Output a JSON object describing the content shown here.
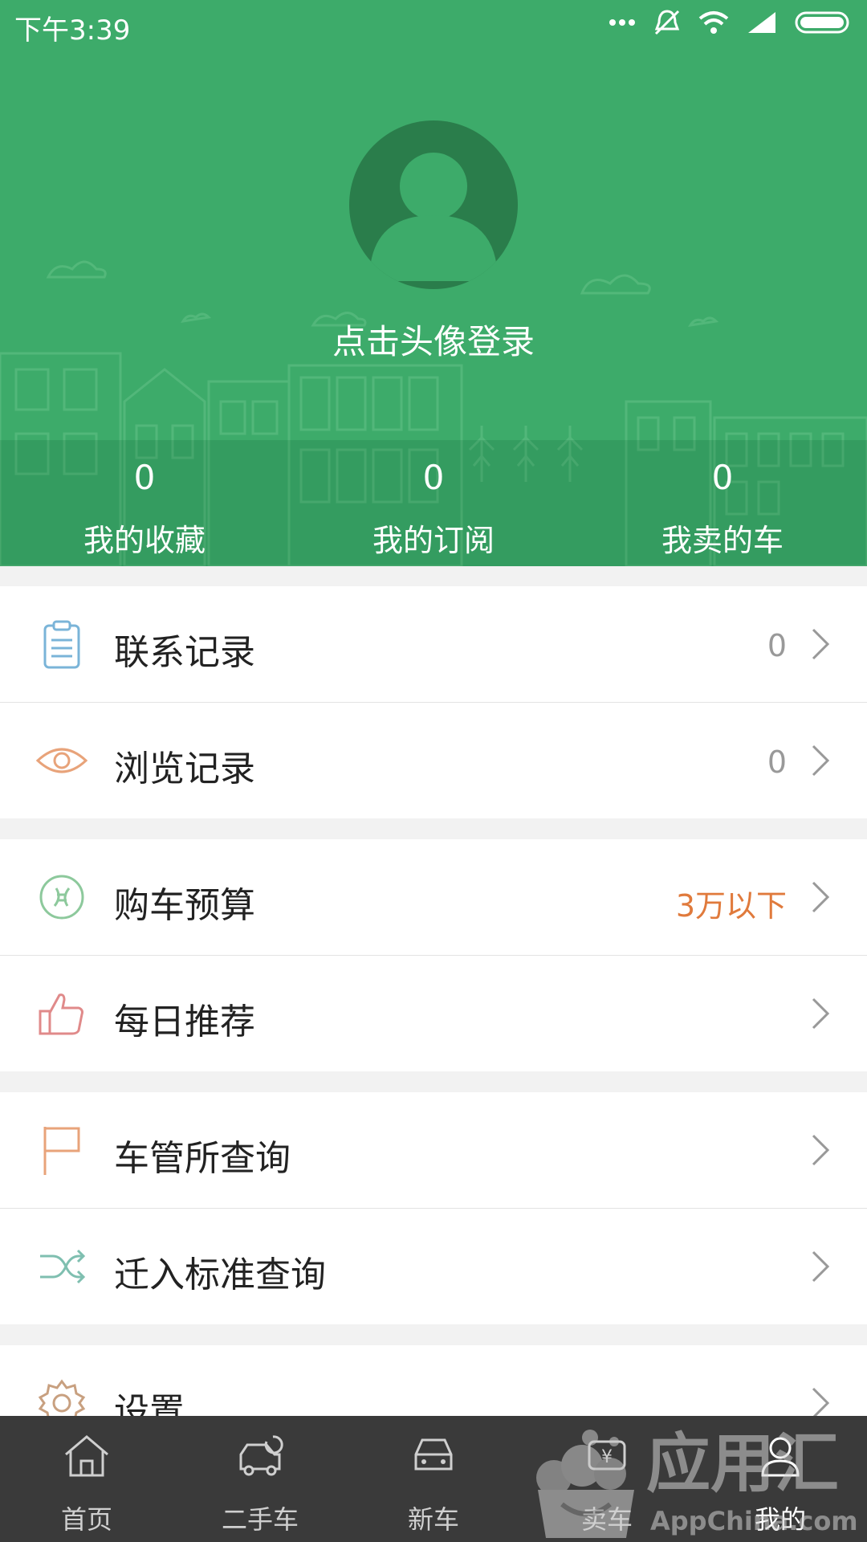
{
  "status_bar": {
    "time": "下午3:39"
  },
  "profile": {
    "login_prompt": "点击头像登录"
  },
  "stats": [
    {
      "count": "0",
      "label": "我的收藏"
    },
    {
      "count": "0",
      "label": "我的订阅"
    },
    {
      "count": "0",
      "label": "我卖的车"
    }
  ],
  "menu": {
    "contact_records": {
      "label": "联系记录",
      "value": "0"
    },
    "browse_history": {
      "label": "浏览记录",
      "value": "0"
    },
    "car_budget": {
      "label": "购车预算",
      "value": "3万以下"
    },
    "daily_recommend": {
      "label": "每日推荐"
    },
    "dmv_query": {
      "label": "车管所查询"
    },
    "transfer_standard": {
      "label": "迁入标准查询"
    },
    "settings": {
      "label": "设置"
    }
  },
  "bottom_nav": [
    {
      "label": "首页",
      "icon": "home-icon"
    },
    {
      "label": "二手车",
      "icon": "used-car-icon"
    },
    {
      "label": "新车",
      "icon": "new-car-icon"
    },
    {
      "label": "卖车",
      "icon": "sell-car-icon"
    },
    {
      "label": "我的",
      "icon": "profile-icon",
      "active": true
    }
  ],
  "watermark": {
    "brand": "应用汇",
    "site": "AppChina.com"
  },
  "colors": {
    "header_green": "#3dab6a",
    "accent_orange": "#e07a3c",
    "nav_bg": "#3a3a3a"
  }
}
